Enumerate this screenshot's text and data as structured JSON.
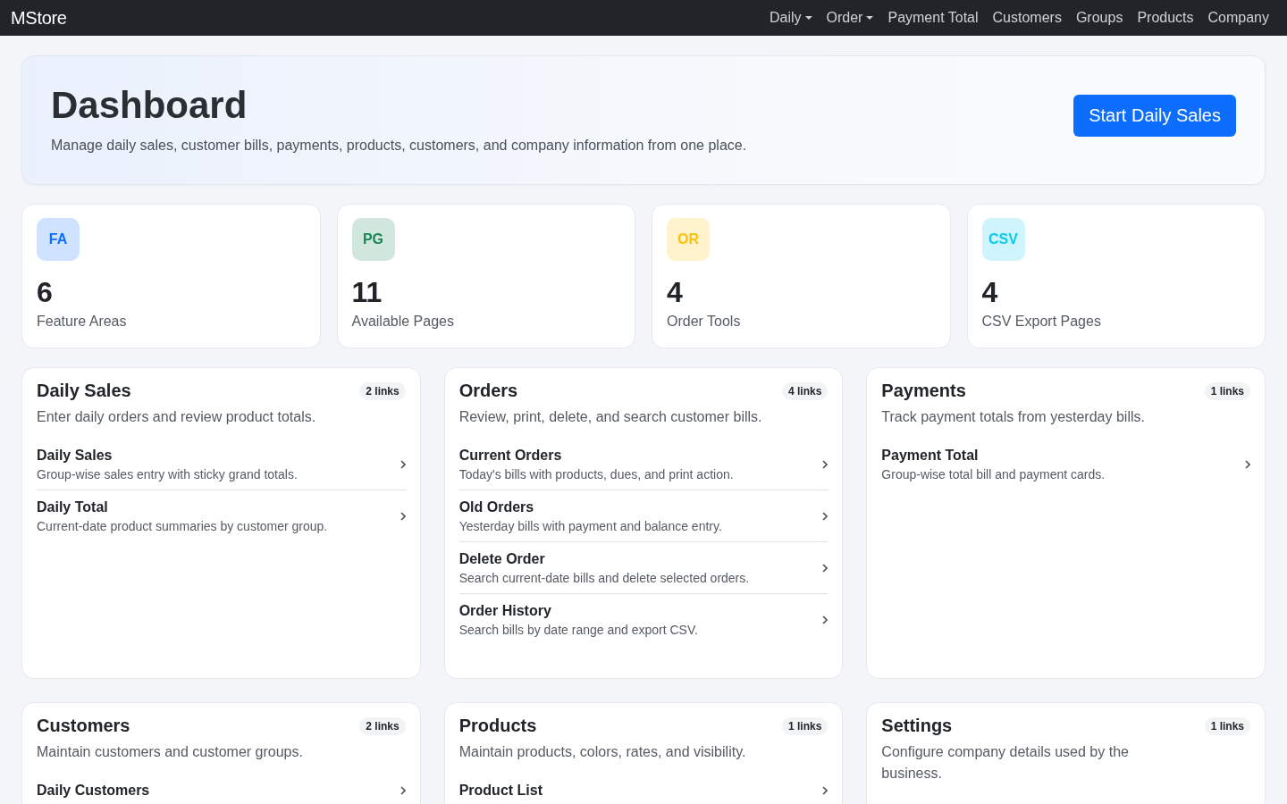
{
  "navbar": {
    "brand": "MStore",
    "items": [
      {
        "label": "Daily",
        "kind": "dropdown"
      },
      {
        "label": "Order",
        "kind": "dropdown"
      },
      {
        "label": "Payment Total",
        "kind": "link"
      },
      {
        "label": "Customers",
        "kind": "link"
      },
      {
        "label": "Groups",
        "kind": "link"
      },
      {
        "label": "Products",
        "kind": "link"
      },
      {
        "label": "Company",
        "kind": "link"
      }
    ]
  },
  "hero": {
    "title": "Dashboard",
    "subtitle": "Manage daily sales, customer bills, payments, products, customers, and company information from one place.",
    "button": "Start Daily Sales"
  },
  "stats": [
    {
      "badge": "FA",
      "color": "#0d6efd",
      "value": "6",
      "label": "Feature Areas"
    },
    {
      "badge": "PG",
      "color": "#198754",
      "value": "11",
      "label": "Available Pages"
    },
    {
      "badge": "OR",
      "color": "#ffc107",
      "value": "4",
      "label": "Order Tools"
    },
    {
      "badge": "CSV",
      "color": "#0dcaf0",
      "value": "4",
      "label": "CSV Export Pages"
    }
  ],
  "sections": [
    {
      "title": "Daily Sales",
      "count": "2 links",
      "description": "Enter daily orders and review product totals.",
      "links": [
        {
          "title": "Daily Sales",
          "description": "Group-wise sales entry with sticky grand totals."
        },
        {
          "title": "Daily Total",
          "description": "Current-date product summaries by customer group."
        }
      ]
    },
    {
      "title": "Orders",
      "count": "4 links",
      "description": "Review, print, delete, and search customer bills.",
      "links": [
        {
          "title": "Current Orders",
          "description": "Today's bills with products, dues, and print action."
        },
        {
          "title": "Old Orders",
          "description": "Yesterday bills with payment and balance entry."
        },
        {
          "title": "Delete Order",
          "description": "Search current-date bills and delete selected orders."
        },
        {
          "title": "Order History",
          "description": "Search bills by date range and export CSV."
        }
      ]
    },
    {
      "title": "Payments",
      "count": "1 links",
      "description": "Track payment totals from yesterday bills.",
      "links": [
        {
          "title": "Payment Total",
          "description": "Group-wise total bill and payment cards."
        }
      ]
    },
    {
      "title": "Customers",
      "count": "2 links",
      "description": "Maintain customers and customer groups.",
      "links": [
        {
          "title": "Daily Customers"
        }
      ]
    },
    {
      "title": "Products",
      "count": "1 links",
      "description": "Maintain products, colors, rates, and visibility.",
      "links": [
        {
          "title": "Product List"
        }
      ]
    },
    {
      "title": "Settings",
      "count": "1 links",
      "description": "Configure company details used by the business."
    }
  ]
}
